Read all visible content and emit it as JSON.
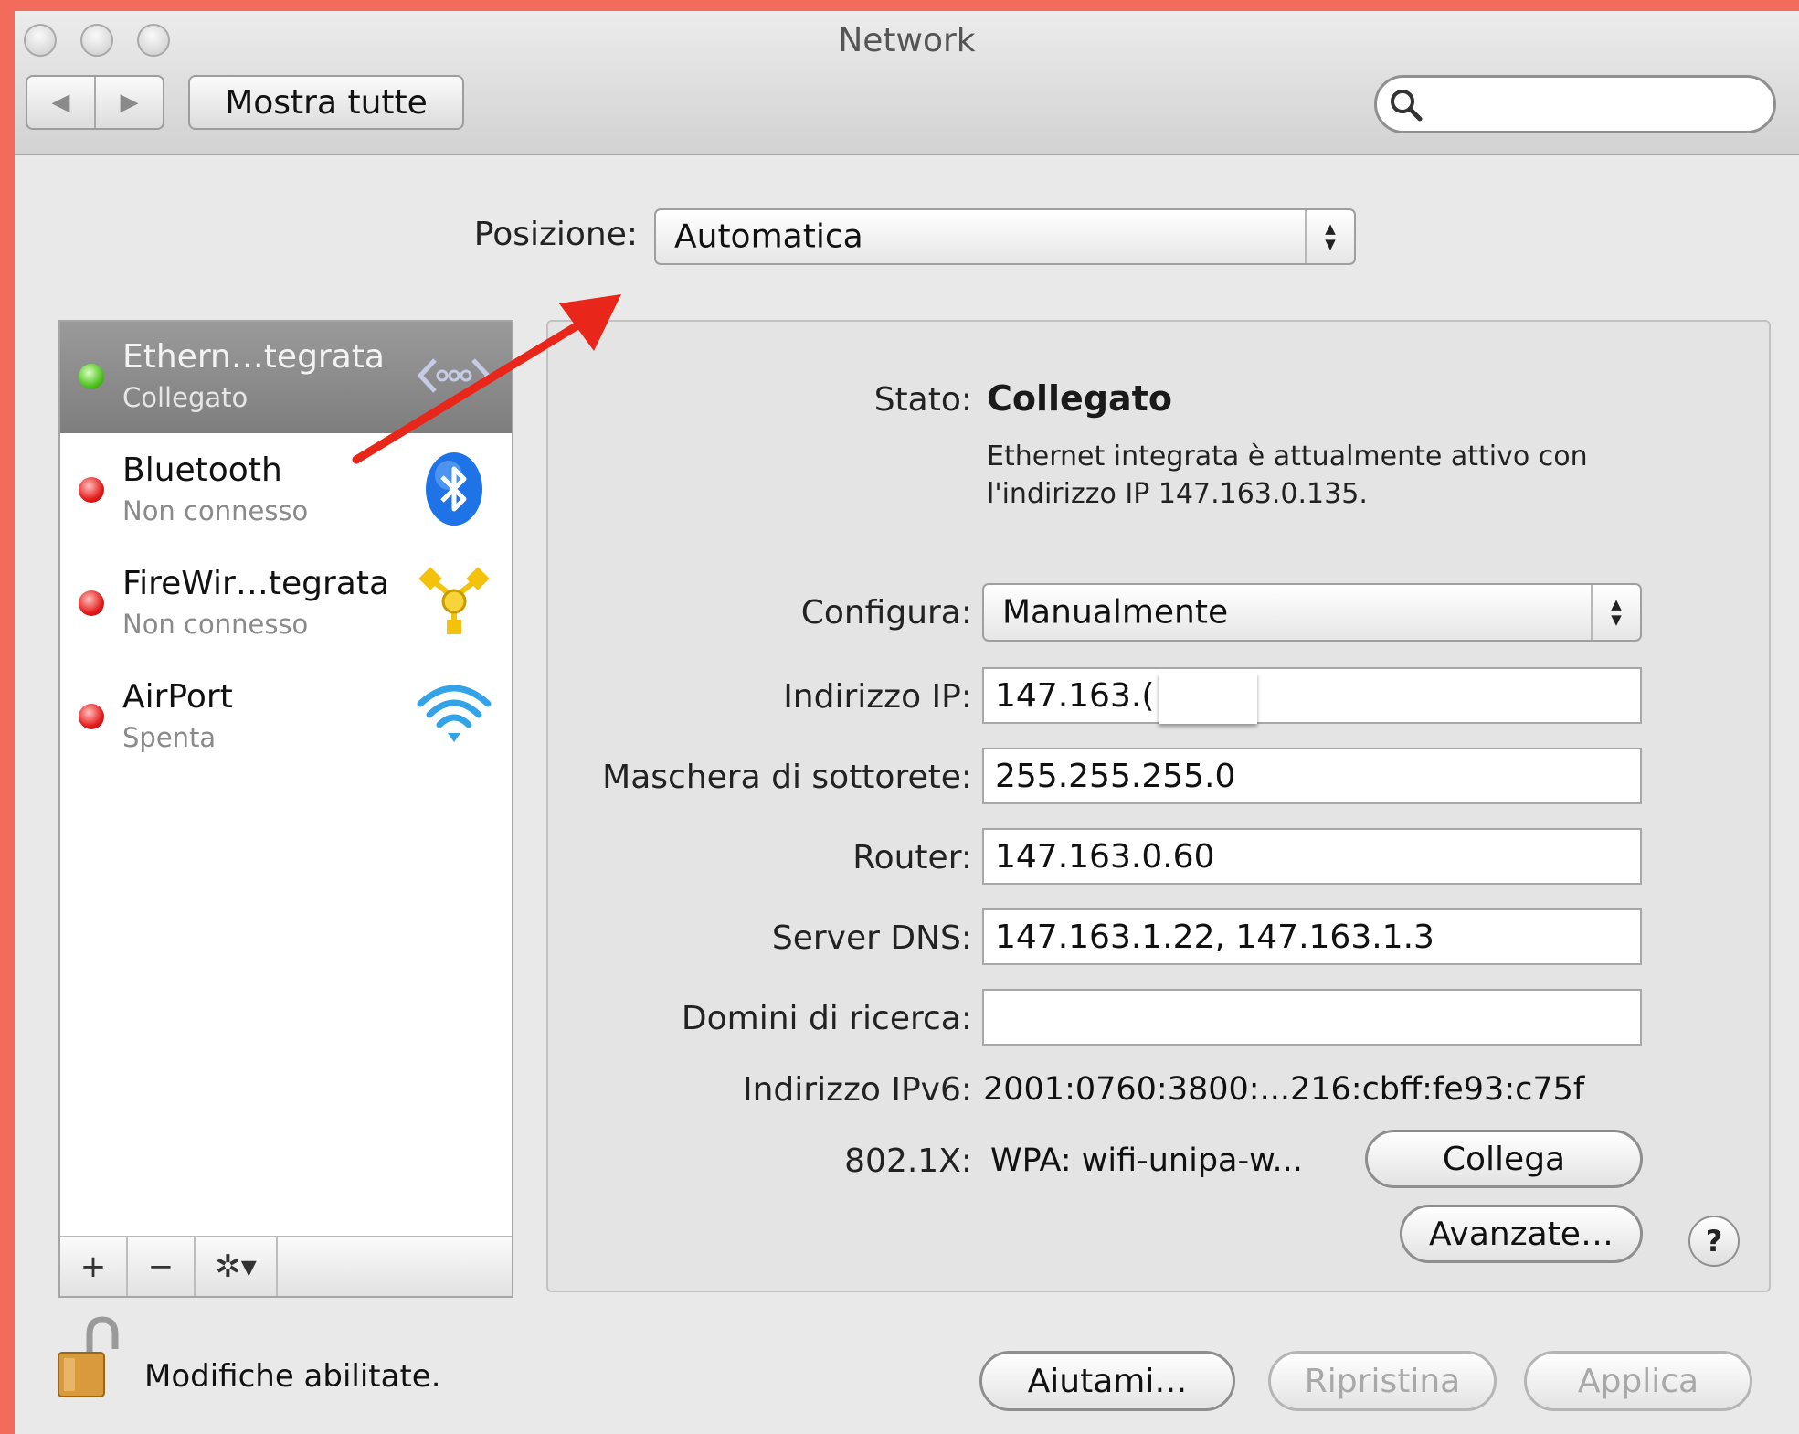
{
  "window": {
    "title": "Network"
  },
  "toolbar": {
    "back": "◀",
    "forward": "▶",
    "show_all": "Mostra tutte",
    "search_value": ""
  },
  "location": {
    "label": "Posizione:",
    "value": "Automatica"
  },
  "services": [
    {
      "name": "Ethern…tegrata",
      "status": "Collegato",
      "indicator": "green",
      "icon": "ethernet-icon"
    },
    {
      "name": "Bluetooth",
      "status": "Non connesso",
      "indicator": "red",
      "icon": "bluetooth-icon"
    },
    {
      "name": "FireWir…tegrata",
      "status": "Non connesso",
      "indicator": "red",
      "icon": "firewire-icon"
    },
    {
      "name": "AirPort",
      "status": "Spenta",
      "indicator": "red",
      "icon": "wifi-icon"
    }
  ],
  "sidebar_tools": {
    "add": "+",
    "remove": "−",
    "gear": "✲▾"
  },
  "detail": {
    "status_label": "Stato:",
    "status_value": "Collegato",
    "status_desc_line1": "Ethernet integrata è attualmente attivo con",
    "status_desc_line2": "l'indirizzo IP 147.163.0.135.",
    "configure_label": "Configura:",
    "configure_value": "Manualmente",
    "ip_label": "Indirizzo IP:",
    "ip_value": "147.163.(",
    "mask_label": "Maschera di sottorete:",
    "mask_value": "255.255.255.0",
    "router_label": "Router:",
    "router_value": "147.163.0.60",
    "dns_label": "Server DNS:",
    "dns_value": "147.163.1.22, 147.163.1.3",
    "search_domains_label": "Domini di ricerca:",
    "search_domains_value": "",
    "ipv6_label": "Indirizzo IPv6:",
    "ipv6_value": "2001:0760:3800:...216:cbff:fe93:c75f",
    "x8021_label": "802.1X:",
    "x8021_value": "WPA: wifi-unipa-w...",
    "connect_button": "Collega",
    "advanced_button": "Avanzate…",
    "help": "?"
  },
  "footer": {
    "lock_text": "Modifiche abilitate.",
    "assist_button": "Aiutami…",
    "revert_button": "Ripristina",
    "apply_button": "Applica"
  },
  "colors": {
    "border": "#f26b5b",
    "annotation_arrow": "#e8271a"
  }
}
